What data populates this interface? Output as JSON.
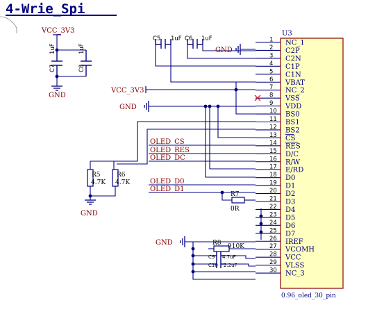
{
  "title": "4-Wrie_Spi",
  "colors": {
    "wire": "#000080",
    "component": "#8b0000",
    "net": "#8b0000",
    "pin_name": "#000080",
    "chip_fill": "#ffffc0",
    "dot": "#000080",
    "nc_cross": "#ff0000"
  },
  "chip": {
    "designator": "U3",
    "part": "0.96_oled_30_pin",
    "pins": [
      {
        "num": "1",
        "name": "NC_1"
      },
      {
        "num": "2",
        "name": "C2P"
      },
      {
        "num": "3",
        "name": "C2N"
      },
      {
        "num": "4",
        "name": "C1P"
      },
      {
        "num": "5",
        "name": "C1N"
      },
      {
        "num": "6",
        "name": "VBAT"
      },
      {
        "num": "7",
        "name": "NC_2"
      },
      {
        "num": "8",
        "name": "VSS"
      },
      {
        "num": "9",
        "name": "VDD"
      },
      {
        "num": "10",
        "name": "BS0"
      },
      {
        "num": "11",
        "name": "BS1"
      },
      {
        "num": "12",
        "name": "BS2"
      },
      {
        "num": "13",
        "name": "CS"
      },
      {
        "num": "14",
        "name": "RES"
      },
      {
        "num": "15",
        "name": "D/C"
      },
      {
        "num": "16",
        "name": "R/W"
      },
      {
        "num": "17",
        "name": "E/RD"
      },
      {
        "num": "18",
        "name": "D0"
      },
      {
        "num": "19",
        "name": "D1"
      },
      {
        "num": "20",
        "name": "D2"
      },
      {
        "num": "21",
        "name": "D3"
      },
      {
        "num": "22",
        "name": "D4"
      },
      {
        "num": "23",
        "name": "D5"
      },
      {
        "num": "24",
        "name": "D6"
      },
      {
        "num": "25",
        "name": "D7"
      },
      {
        "num": "26",
        "name": "IREF"
      },
      {
        "num": "27",
        "name": "VCOMH"
      },
      {
        "num": "28",
        "name": "VCC"
      },
      {
        "num": "29",
        "name": "VLSS"
      },
      {
        "num": "30",
        "name": "NC_3"
      }
    ]
  },
  "nets": {
    "vcc_left": "VCC_3V3",
    "vcc_vbat": "VCC_3V3",
    "gnd_left": "GND",
    "gnd_top": "GND",
    "gnd_vss": "GND",
    "gnd_res": "GND",
    "gnd_bottom": "GND",
    "oled_cs": "OLED_CS",
    "oled_res": "OLED_RES",
    "oled_dc": "OLED_DC",
    "oled_d0": "OLED_D0",
    "oled_d1": "OLED_D1"
  },
  "components": {
    "c5": {
      "ref": "C5",
      "value": "1uF"
    },
    "c6": {
      "ref": "C6",
      "value": "1uF"
    },
    "c7": {
      "ref": "C7",
      "value": "1uF"
    },
    "c8": {
      "ref": "C8",
      "value": "1uF"
    },
    "c9": {
      "ref": "C9",
      "value": "4.7uF"
    },
    "c10": {
      "ref": "C10",
      "value": "2.2uF"
    },
    "r5": {
      "ref": "R5",
      "value": "4.7K"
    },
    "r6": {
      "ref": "R6",
      "value": "4.7K"
    },
    "r7": {
      "ref": "R7",
      "value": "0R"
    },
    "r8": {
      "ref": "R8",
      "value": "910K"
    }
  }
}
